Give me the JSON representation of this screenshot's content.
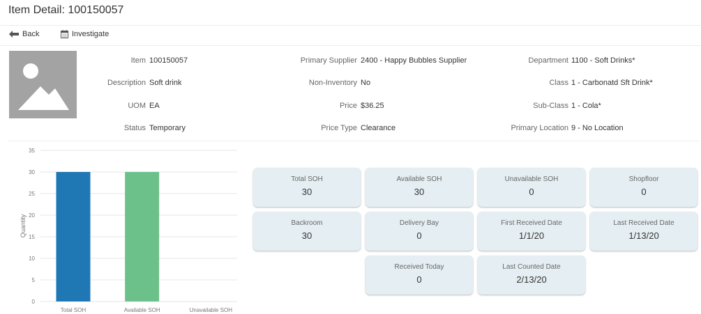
{
  "page": {
    "title": "Item Detail: 100150057"
  },
  "toolbar": {
    "back_label": "Back",
    "investigate_label": "Investigate"
  },
  "details": {
    "col1": [
      {
        "label": "Item",
        "value": "100150057"
      },
      {
        "label": "Description",
        "value": "Soft drink"
      },
      {
        "label": "UOM",
        "value": "EA"
      },
      {
        "label": "Status",
        "value": "Temporary"
      }
    ],
    "col2": [
      {
        "label": "Primary Supplier",
        "value": "2400 - Happy Bubbles Supplier"
      },
      {
        "label": "Non-Inventory",
        "value": "No"
      },
      {
        "label": "Price",
        "value": "$36.25"
      },
      {
        "label": "Price Type",
        "value": "Clearance"
      }
    ],
    "col3": [
      {
        "label": "Department",
        "value": "1100 - Soft Drinks*"
      },
      {
        "label": "Class",
        "value": "1 - Carbonatd Sft Drink*"
      },
      {
        "label": "Sub-Class",
        "value": "1 - Cola*"
      },
      {
        "label": "Primary Location",
        "value": "9 - No Location"
      }
    ]
  },
  "chart_data": {
    "type": "bar",
    "categories": [
      "Total SOH",
      "Available SOH",
      "Unavailable SOH"
    ],
    "values": [
      30,
      30,
      0
    ],
    "colors": [
      "#1f77b4",
      "#6cc18a",
      "#999999"
    ],
    "ylabel": "Quantity",
    "ylim": [
      0,
      35
    ],
    "yticks": [
      0,
      5,
      10,
      15,
      20,
      25,
      30,
      35
    ],
    "grid": true
  },
  "cards": [
    {
      "label": "Total SOH",
      "value": "30"
    },
    {
      "label": "Available SOH",
      "value": "30"
    },
    {
      "label": "Unavailable SOH",
      "value": "0"
    },
    {
      "label": "Shopfloor",
      "value": "0"
    },
    {
      "label": "Backroom",
      "value": "30"
    },
    {
      "label": "Delivery Bay",
      "value": "0"
    },
    {
      "label": "First Received Date",
      "value": "1/1/20"
    },
    {
      "label": "Last Received Date",
      "value": "1/13/20"
    },
    {
      "label": "Received Today",
      "value": "0"
    },
    {
      "label": "Last Counted Date",
      "value": "2/13/20"
    }
  ]
}
